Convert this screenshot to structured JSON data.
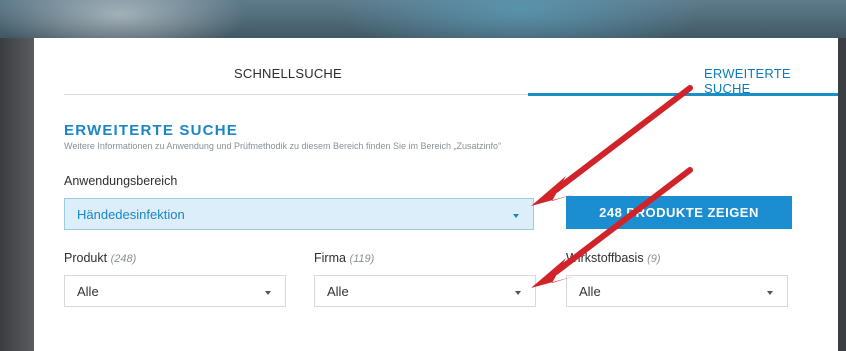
{
  "tabs": {
    "quick": "SCHNELLSUCHE",
    "advanced": "ERWEITERTE SUCHE"
  },
  "section": {
    "title": "ERWEITERTE SUCHE",
    "subtitle": "Weitere Informationen zu Anwendung und Prüfmethodik zu diesem Bereich finden Sie im Bereich „Zusatzinfo“"
  },
  "application_area": {
    "label": "Anwendungsbereich",
    "value": "Händedesinfektion"
  },
  "show_button": {
    "label": "248 PRODUKTE ZEIGEN"
  },
  "filters": {
    "product": {
      "label": "Produkt",
      "count": "(248)",
      "value": "Alle"
    },
    "company": {
      "label": "Firma",
      "count": "(119)",
      "value": "Alle"
    },
    "substance": {
      "label": "Wirkstoffbasis",
      "count": "(9)",
      "value": "Alle"
    }
  },
  "annotations": {
    "arrow_color": "#d0232a"
  }
}
